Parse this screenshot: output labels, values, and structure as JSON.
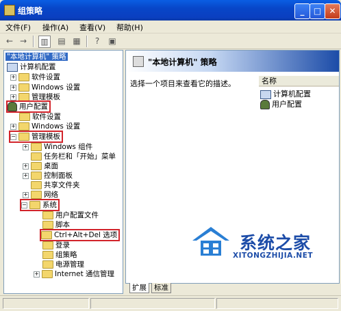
{
  "window": {
    "title": "组策略",
    "minimize": "_",
    "maximize": "□",
    "close": "✕"
  },
  "menu": [
    "文件(F)",
    "操作(A)",
    "查看(V)",
    "帮助(H)"
  ],
  "tree": {
    "root": "\"本地计算机\" 策略",
    "computer_config": "计算机配置",
    "cc_software": "软件设置",
    "cc_windows": "Windows 设置",
    "cc_admin": "管理模板",
    "user_config": "用户配置",
    "uc_software": "软件设置",
    "uc_windows": "Windows 设置",
    "uc_admin": "管理模板",
    "admin_children": [
      "Windows 组件",
      "任务栏和「开始」菜单",
      "桌面",
      "控制面板",
      "共享文件夹",
      "网络",
      "系统"
    ],
    "system_children": [
      "用户配置文件",
      "脚本",
      "Ctrl+Alt+Del 选项",
      "登录",
      "组策略",
      "电源管理",
      "Internet 通信管理"
    ]
  },
  "right": {
    "header": "\"本地计算机\" 策略",
    "description": "选择一个项目来查看它的描述。",
    "column_name": "名称",
    "items": [
      "计算机配置",
      "用户配置"
    ]
  },
  "tabs": [
    "扩展",
    "标准"
  ],
  "watermark": {
    "brand": "系统之家",
    "url": "XITONGZHIJIA.NET"
  }
}
